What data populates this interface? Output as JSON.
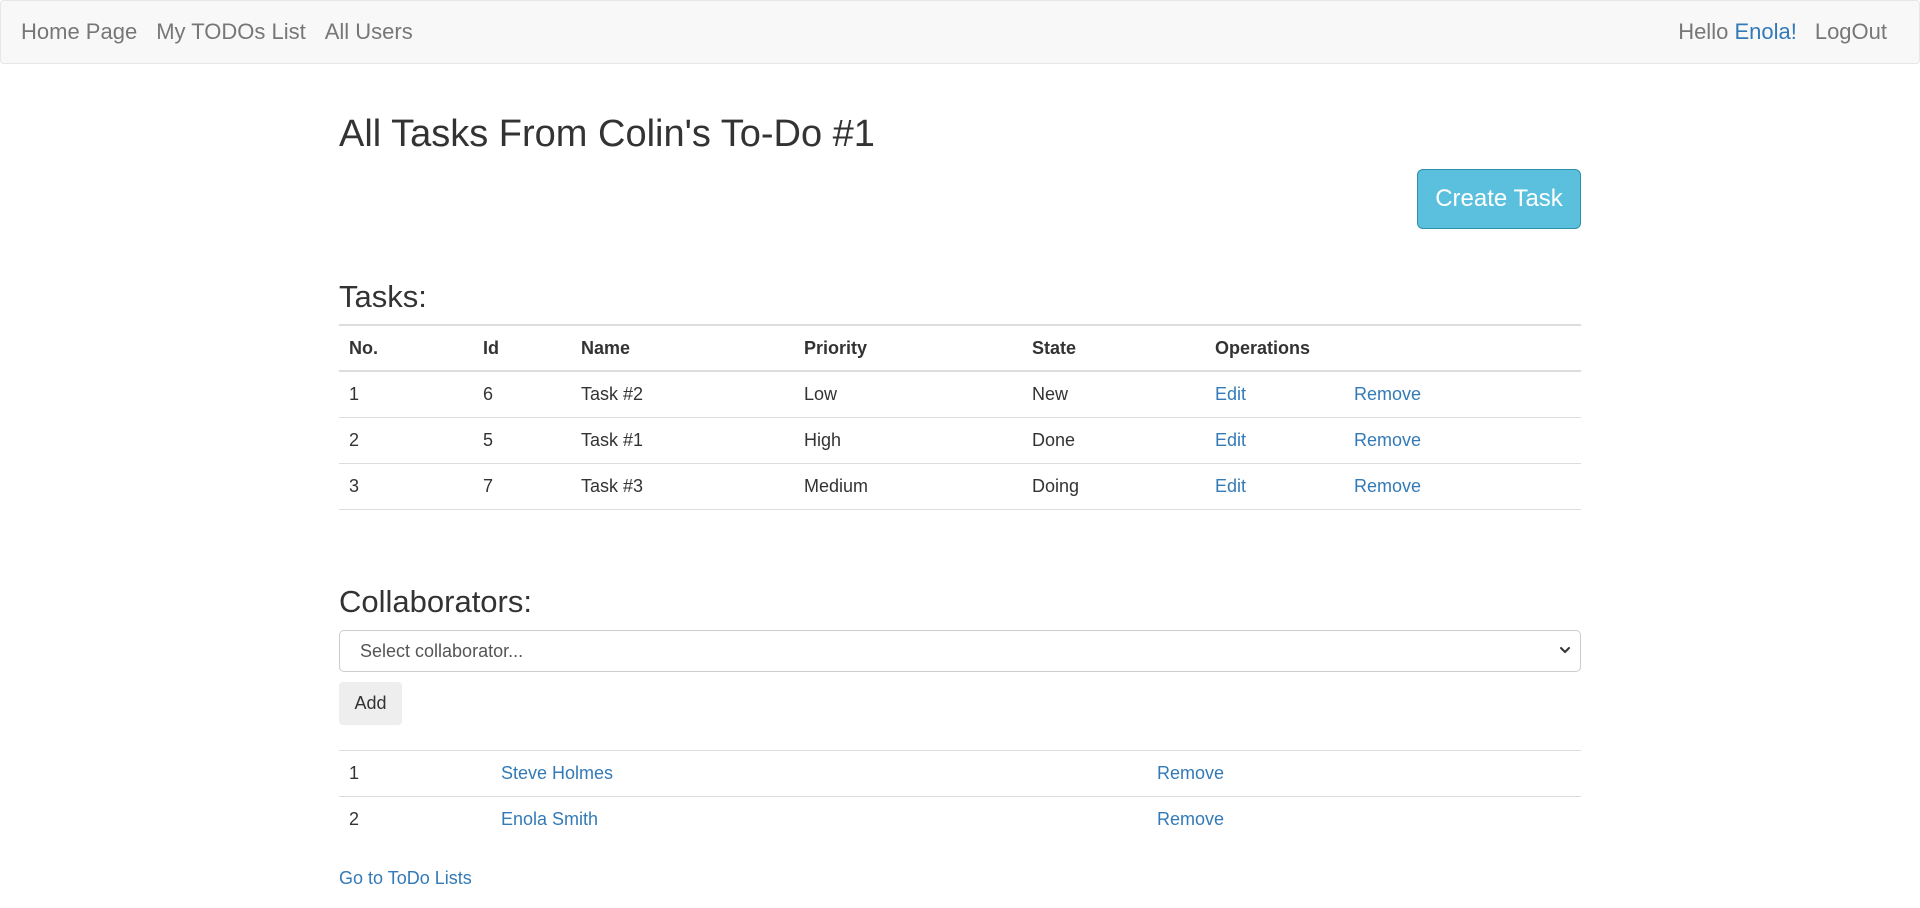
{
  "navbar": {
    "links": [
      "Home Page",
      "My TODOs List",
      "All Users"
    ],
    "greeting": "Hello ",
    "username": "Enola!",
    "logout_label": "LogOut"
  },
  "page": {
    "title": "All Tasks From Colin's To-Do #1",
    "create_task_label": "Create Task"
  },
  "tasks": {
    "heading": "Tasks:",
    "columns": [
      "No.",
      "Id",
      "Name",
      "Priority",
      "State",
      "Operations"
    ],
    "rows": [
      {
        "no": "1",
        "id": "6",
        "name": "Task #2",
        "priority": "Low",
        "state": "New",
        "edit": "Edit",
        "remove": "Remove"
      },
      {
        "no": "2",
        "id": "5",
        "name": "Task #1",
        "priority": "High",
        "state": "Done",
        "edit": "Edit",
        "remove": "Remove"
      },
      {
        "no": "3",
        "id": "7",
        "name": "Task #3",
        "priority": "Medium",
        "state": "Doing",
        "edit": "Edit",
        "remove": "Remove"
      }
    ]
  },
  "collaborators": {
    "heading": "Collaborators:",
    "select_value": "Select collaborator...",
    "add_label": "Add",
    "rows": [
      {
        "no": "1",
        "name": "Steve Holmes",
        "remove": "Remove"
      },
      {
        "no": "2",
        "name": "Enola Smith",
        "remove": "Remove"
      }
    ]
  },
  "footer": {
    "back_link": "Go to ToDo Lists"
  },
  "colors": {
    "link": "#337ab7",
    "primary_button": "#5bc0de",
    "navbar_bg": "#f8f8f8"
  },
  "icons": {
    "select_chevron": "chevron-down-icon"
  }
}
